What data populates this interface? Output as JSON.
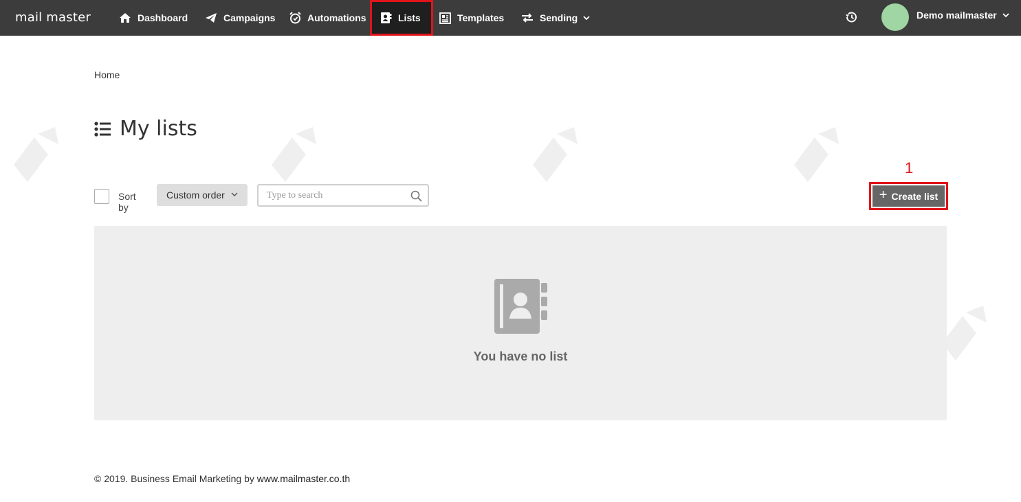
{
  "app": {
    "logo": "mail master"
  },
  "nav": {
    "items": [
      {
        "label": "Dashboard",
        "icon": "home-icon"
      },
      {
        "label": "Campaigns",
        "icon": "paper-plane-icon"
      },
      {
        "label": "Automations",
        "icon": "alarm-clock-icon"
      },
      {
        "label": "Lists",
        "icon": "address-book-icon",
        "active": true
      },
      {
        "label": "Templates",
        "icon": "template-icon"
      },
      {
        "label": "Sending",
        "icon": "exchange-icon",
        "dropdown": true
      }
    ],
    "user_name": "Demo mailmaster"
  },
  "breadcrumb": "Home",
  "page": {
    "title": "My lists",
    "step_marker": "1"
  },
  "toolbar": {
    "sort_label": "Sort by",
    "sort_value": "Custom order",
    "search_placeholder": "Type to search",
    "create_label": "Create list"
  },
  "empty_state": {
    "message": "You have no list"
  },
  "footer": {
    "text": "© 2019. Business Email Marketing by ",
    "link": "www.mailmaster.co.th"
  },
  "colors": {
    "topbar": "#3c3c3c",
    "active_nav": "#1f1f1f",
    "highlight": "#e0141a",
    "button": "#666666",
    "panel": "#eeeeee",
    "avatar": "#9fd6a3"
  }
}
